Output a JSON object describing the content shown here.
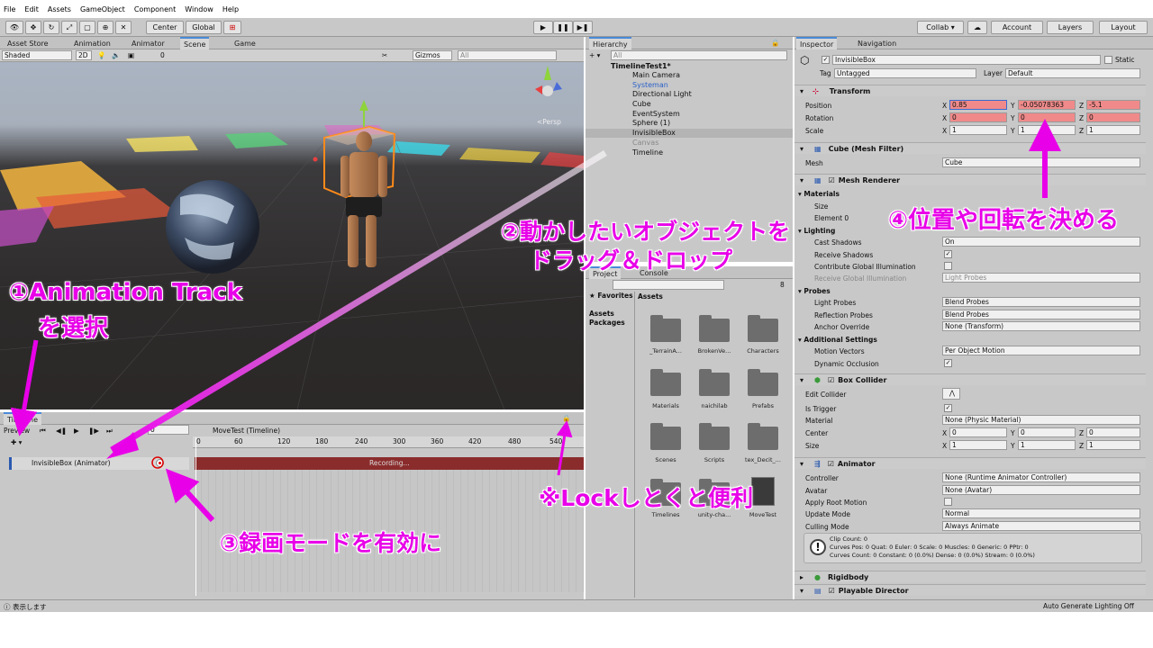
{
  "menu": [
    "File",
    "Edit",
    "Assets",
    "GameObject",
    "Component",
    "Window",
    "Help"
  ],
  "toolbar": {
    "pivot": "Center",
    "space": "Global",
    "collab": "Collab ▾",
    "account": "Account",
    "layers": "Layers",
    "layout": "Layout"
  },
  "scene_tabs": [
    "Asset Store",
    "Animation",
    "Animator",
    "Scene",
    "Game"
  ],
  "scene_toolbar": {
    "shading": "Shaded",
    "mode2d": "2D",
    "gizmos": "Gizmos",
    "search_placeholder": "All",
    "hidden_count": "0"
  },
  "scene_gizmo_label": "<Persp",
  "hierarchy": {
    "tab": "Hierarchy",
    "search_placeholder": "All",
    "root": "TimelineTest1*",
    "items": [
      "Main Camera",
      "Systeman",
      "Directional Light",
      "Cube",
      "EventSystem",
      "Sphere (1)",
      "InvisibleBox",
      "Canvas",
      "Timeline"
    ]
  },
  "project": {
    "tabs": [
      "Project",
      "Console"
    ],
    "favorites": "Favorites",
    "assets_label": "Assets",
    "tree": [
      "Assets",
      "Packages"
    ],
    "search_count": "8",
    "folders": [
      "_TerrainA...",
      "BrokenVe...",
      "Characters",
      "Materials",
      "naichilab",
      "Prefabs",
      "Scenes",
      "Scripts",
      "tex_Decit_...",
      "Timelines",
      "unity-cha...",
      "MoveTest"
    ]
  },
  "inspector": {
    "tabs": [
      "Inspector",
      "Navigation"
    ],
    "object_name": "InvisibleBox",
    "static": "Static",
    "tag_label": "Tag",
    "tag": "Untagged",
    "layer_label": "Layer",
    "layer": "Default",
    "transform": {
      "title": "Transform",
      "position_label": "Position",
      "rotation_label": "Rotation",
      "scale_label": "Scale",
      "pos": [
        "0.85",
        "-0.05078363",
        "-5.1"
      ],
      "rot": [
        "0",
        "0",
        "0"
      ],
      "scale": [
        "1",
        "1",
        "1"
      ]
    },
    "mesh_filter": {
      "title": "Cube (Mesh Filter)",
      "mesh_label": "Mesh",
      "mesh": "Cube"
    },
    "mesh_renderer": {
      "title": "Mesh Renderer",
      "materials": "Materials",
      "size": "Size",
      "element0": "Element 0",
      "lighting": "Lighting",
      "cast_shadows": "Cast Shadows",
      "cast_shadows_val": "On",
      "receive_shadows": "Receive Shadows",
      "contribute_gi": "Contribute Global Illumination",
      "receive_gi": "Receive Global Illumination",
      "receive_gi_val": "Light Probes",
      "probes": "Probes",
      "light_probes": "Light Probes",
      "light_probes_val": "Blend Probes",
      "reflection_probes": "Reflection Probes",
      "reflection_probes_val": "Blend Probes",
      "anchor_override": "Anchor Override",
      "anchor_override_val": "None (Transform)",
      "additional": "Additional Settings",
      "motion_vectors": "Motion Vectors",
      "motion_vectors_val": "Per Object Motion",
      "dynamic_occlusion": "Dynamic Occlusion"
    },
    "box_collider": {
      "title": "Box Collider",
      "edit_collider": "Edit Collider",
      "is_trigger": "Is Trigger",
      "material": "Material",
      "material_val": "None (Physic Material)",
      "center": "Center",
      "center_val": [
        "0",
        "0",
        "0"
      ],
      "size": "Size",
      "size_val": [
        "1",
        "1",
        "1"
      ]
    },
    "animator": {
      "title": "Animator",
      "controller": "Controller",
      "controller_val": "None (Runtime Animator Controller)",
      "avatar": "Avatar",
      "avatar_val": "None (Avatar)",
      "apply_root_motion": "Apply Root Motion",
      "update_mode": "Update Mode",
      "update_mode_val": "Normal",
      "culling_mode": "Culling Mode",
      "culling_mode_val": "Always Animate",
      "info": [
        "Clip Count: 0",
        "Curves Pos: 0 Quat: 0 Euler: 0 Scale: 0 Muscles: 0 Generic: 0 PPtr: 0",
        "Curves Count: 0 Constant: 0 (0.0%) Dense: 0 (0.0%) Stream: 0 (0.0%)"
      ]
    },
    "rigidbody": "Rigidbody",
    "playable_director": "Playable Director"
  },
  "timeline": {
    "tab": "Timeline",
    "preview": "Preview",
    "frame": "0",
    "asset": "MoveTest (Timeline)",
    "ruler": [
      "0",
      "60",
      "120",
      "180",
      "240",
      "300",
      "360",
      "420",
      "480",
      "540"
    ],
    "track": "InvisibleBox (Animator)",
    "recording": "Recording..."
  },
  "status": {
    "left": "表示します",
    "right": "Auto Generate Lighting Off"
  },
  "annotations": {
    "a1_line1": "①Animation Track",
    "a1_line2": "を選択",
    "a2_line1": "②動かしたいオブジェクトを",
    "a2_line2": "ドラッグ＆ドロップ",
    "a3": "③録画モードを有効に",
    "a4": "④位置や回転を決める",
    "lock": "※Lockしとくと便利"
  },
  "colors": {
    "annotation": "#e800e8",
    "record_red": "#8b2c2c",
    "field_red": "#f08a8a",
    "accent_blue": "#4a8ad8"
  }
}
